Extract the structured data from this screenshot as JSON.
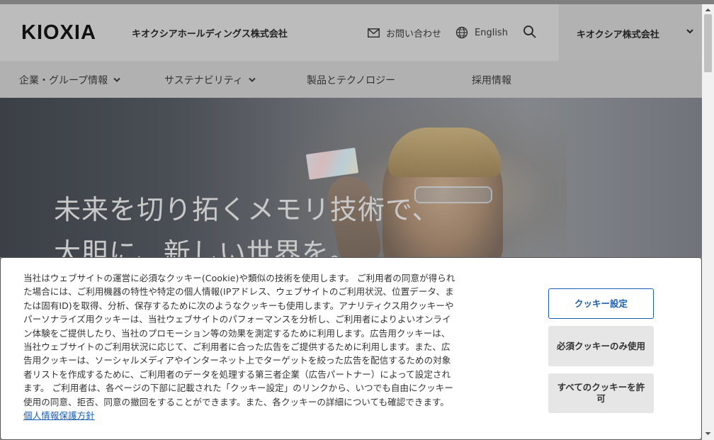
{
  "header": {
    "logo_text": "KIOXIA",
    "holdings_name": "キオクシアホールディングス株式会社",
    "contact_label": "お問い合わせ",
    "language_label": "English",
    "company_selector": "キオクシア株式会社"
  },
  "nav": {
    "items": [
      {
        "label": "企業・グループ情報"
      },
      {
        "label": "サステナビリティ"
      },
      {
        "label": "製品とテクノロジー"
      },
      {
        "label": "採用情報"
      }
    ]
  },
  "hero": {
    "line1": "未来を切り拓くメモリ技術で、",
    "line2": "大胆に、新しい世界を。"
  },
  "cookie_banner": {
    "text": "当社はウェブサイトの運営に必須なクッキー(Cookie)や類似の技術を使用します。 ご利用者の同意が得られた場合には、ご利用機器の特性や特定の個人情報(IPアドレス、ウェブサイトのご利用状況、位置データ、または固有ID)を取得、分析、保存するために次のようなクッキーも使用します。アナリティクス用クッキーやパーソナライズ用クッキーは、当社ウェブサイトのパフォーマンスを分析し、ご利用者によりよいオンライン体験をご提供したり、当社のプロモーション等の効果を測定するために利用します。広告用クッキーは、当社ウェブサイトのご利用状況に応じて、ご利用者に合った広告をご提供するために利用します。また、広告用クッキーは、ソーシャルメディアやインターネット上でターゲットを絞った広告を配信するための対象者リストを作成するために、ご利用者のデータを処理する第三者企業（広告パートナー）によって設定されます。 ご利用者は、各ページの下部に記載された「クッキー設定」のリンクから、いつでも自由にクッキー使用の同意、拒否、同意の撤回をすることができます。また、各クッキーの詳細についても確認できます。",
    "privacy_link": "個人情報保護方針",
    "settings_button": "クッキー設定",
    "required_only_button": "必須クッキーのみ使用",
    "accept_all_button": "すべてのクッキーを許可"
  },
  "colors": {
    "accent": "#1a5fb4",
    "button_grey": "#e6e6e6"
  },
  "icons": [
    "mail-icon",
    "globe-icon",
    "search-icon",
    "chevron-down-icon",
    "scroll-up-icon",
    "scroll-down-icon"
  ]
}
